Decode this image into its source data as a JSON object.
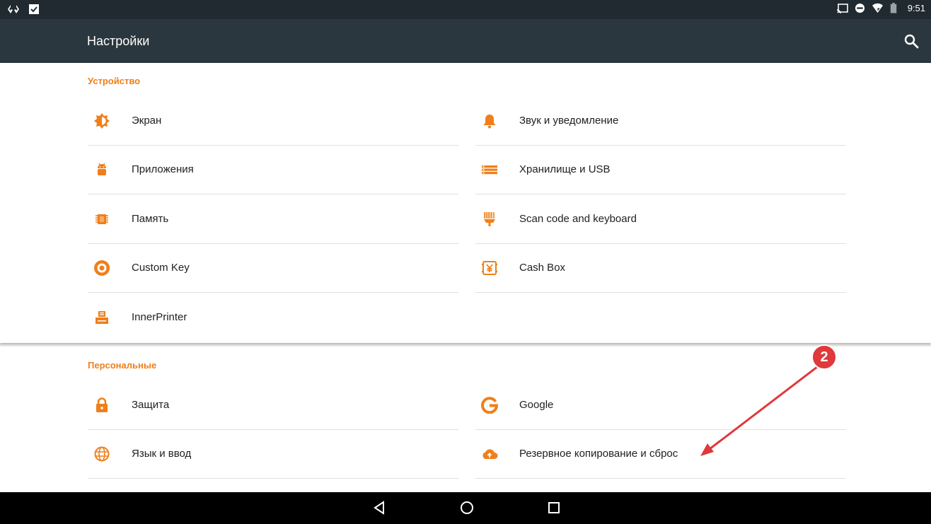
{
  "status_bar": {
    "time": "9:51",
    "left_icons": [
      "sync-icon",
      "checklist-icon"
    ],
    "right_icons": [
      "cast-icon",
      "do-not-disturb-icon",
      "wifi-icon",
      "battery-icon"
    ]
  },
  "toolbar": {
    "title": "Настройки",
    "search_icon": "search-icon"
  },
  "sections": {
    "device": {
      "title": "Устройство",
      "items": [
        {
          "label": "Экран",
          "icon": "brightness-icon"
        },
        {
          "label": "Звук и уведомление",
          "icon": "bell-icon"
        },
        {
          "label": "Приложения",
          "icon": "android-icon"
        },
        {
          "label": "Хранилище и USB",
          "icon": "storage-icon"
        },
        {
          "label": "Память",
          "icon": "memory-icon"
        },
        {
          "label": "Scan code and keyboard",
          "icon": "scanner-icon"
        },
        {
          "label": "Custom Key",
          "icon": "custom-key-icon"
        },
        {
          "label": "Cash Box",
          "icon": "cash-box-icon"
        },
        {
          "label": "InnerPrinter",
          "icon": "printer-icon"
        }
      ]
    },
    "personal": {
      "title": "Персональные",
      "items": [
        {
          "label": "Защита",
          "icon": "lock-icon"
        },
        {
          "label": "Google",
          "icon": "google-icon"
        },
        {
          "label": "Язык и ввод",
          "icon": "globe-icon"
        },
        {
          "label": "Резервное копирование и сброс",
          "icon": "cloud-upload-icon"
        }
      ]
    }
  },
  "annotation": {
    "badge_number": "2",
    "color": "#e0383b"
  },
  "navigation_bar": {
    "buttons": [
      "back-icon",
      "home-icon",
      "recents-icon"
    ]
  },
  "colors": {
    "accent": "#ef7f1a",
    "toolbar": "#2b373e",
    "status_bar": "#202a30"
  }
}
